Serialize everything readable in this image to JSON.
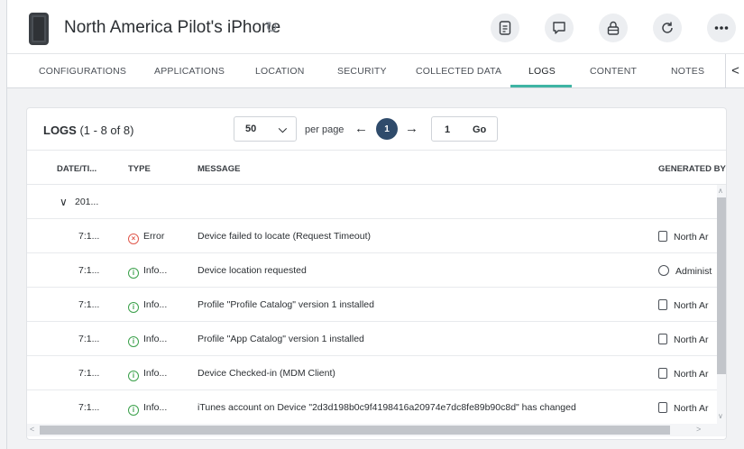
{
  "header": {
    "title": "North America Pilot's iPhone",
    "icons": [
      "phone-icon",
      "sync-icon",
      "document-icon",
      "chat-icon",
      "lock-icon",
      "refresh-icon",
      "more-icon"
    ]
  },
  "tabs": [
    {
      "label": "CONFIGURATIONS"
    },
    {
      "label": "APPLICATIONS"
    },
    {
      "label": "LOCATION"
    },
    {
      "label": "SECURITY"
    },
    {
      "label": "COLLECTED DATA"
    },
    {
      "label": "LOGS",
      "active": true
    },
    {
      "label": "CONTENT"
    },
    {
      "label": "NOTES"
    }
  ],
  "tab_arrow": "<",
  "logs": {
    "title": "LOGS",
    "count": "(1 - 8 of 8)",
    "per_page_value": "50",
    "per_page_label": "per page",
    "current_page": "1",
    "page_input_value": "1",
    "go_label": "Go",
    "columns": {
      "date": "DATE/TI...",
      "type": "TYPE",
      "message": "MESSAGE",
      "generated_by": "GENERATED BY"
    },
    "group_label": "201...",
    "rows": [
      {
        "time": "7:1...",
        "type": "Error",
        "type_kind": "error",
        "message": "Device failed to locate (Request Timeout)",
        "generated_by": "North Ar",
        "gen_kind": "device"
      },
      {
        "time": "7:1...",
        "type": "Info...",
        "type_kind": "info",
        "message": "Device location requested",
        "generated_by": "Administ",
        "gen_kind": "user"
      },
      {
        "time": "7:1...",
        "type": "Info...",
        "type_kind": "info",
        "message": "Profile \"Profile Catalog\" version 1 installed",
        "generated_by": "North Ar",
        "gen_kind": "device"
      },
      {
        "time": "7:1...",
        "type": "Info...",
        "type_kind": "info",
        "message": "Profile \"App Catalog\" version 1 installed",
        "generated_by": "North Ar",
        "gen_kind": "device"
      },
      {
        "time": "7:1...",
        "type": "Info...",
        "type_kind": "info",
        "message": "Device Checked-in (MDM Client)",
        "generated_by": "North Ar",
        "gen_kind": "device"
      },
      {
        "time": "7:1...",
        "type": "Info...",
        "type_kind": "info",
        "message": "iTunes account on Device \"2d3d198b0c9f4198416a20974e7dc8fe89b90c8d\" has changed",
        "generated_by": "North Ar",
        "gen_kind": "device"
      }
    ]
  },
  "colors": {
    "accent_tab": "#3fb4a4",
    "page_circle": "#2f4b6b",
    "error": "#e0584c",
    "info": "#3aa04a"
  }
}
